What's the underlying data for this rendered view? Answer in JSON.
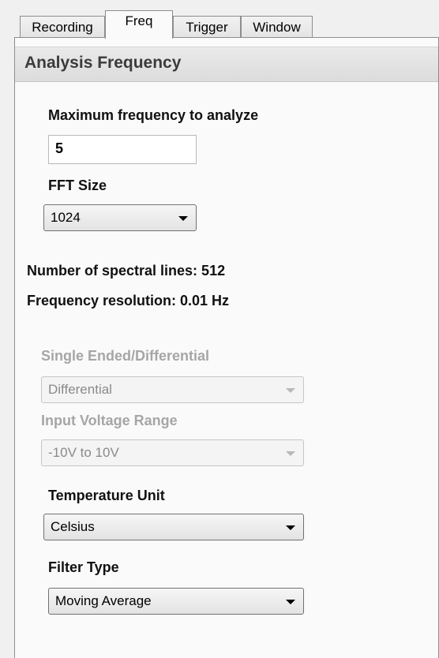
{
  "tabs": [
    {
      "label": "Recording"
    },
    {
      "label": "Freq"
    },
    {
      "label": "Trigger"
    },
    {
      "label": "Window"
    }
  ],
  "panel": {
    "title": "Analysis Frequency",
    "max_freq_label": "Maximum frequency to analyze",
    "max_freq_value": "5",
    "fft_label": "FFT Size",
    "fft_value": "1024",
    "spectral_lines": "Number of spectral lines: 512",
    "freq_resolution": "Frequency resolution: 0.01 Hz",
    "single_diff_label": "Single Ended/Differential",
    "single_diff_value": "Differential",
    "voltage_label": "Input Voltage Range",
    "voltage_value": "-10V to 10V",
    "temp_label": "Temperature Unit",
    "temp_value": "Celsius",
    "filter_label": "Filter Type",
    "filter_value": "Moving Average"
  }
}
